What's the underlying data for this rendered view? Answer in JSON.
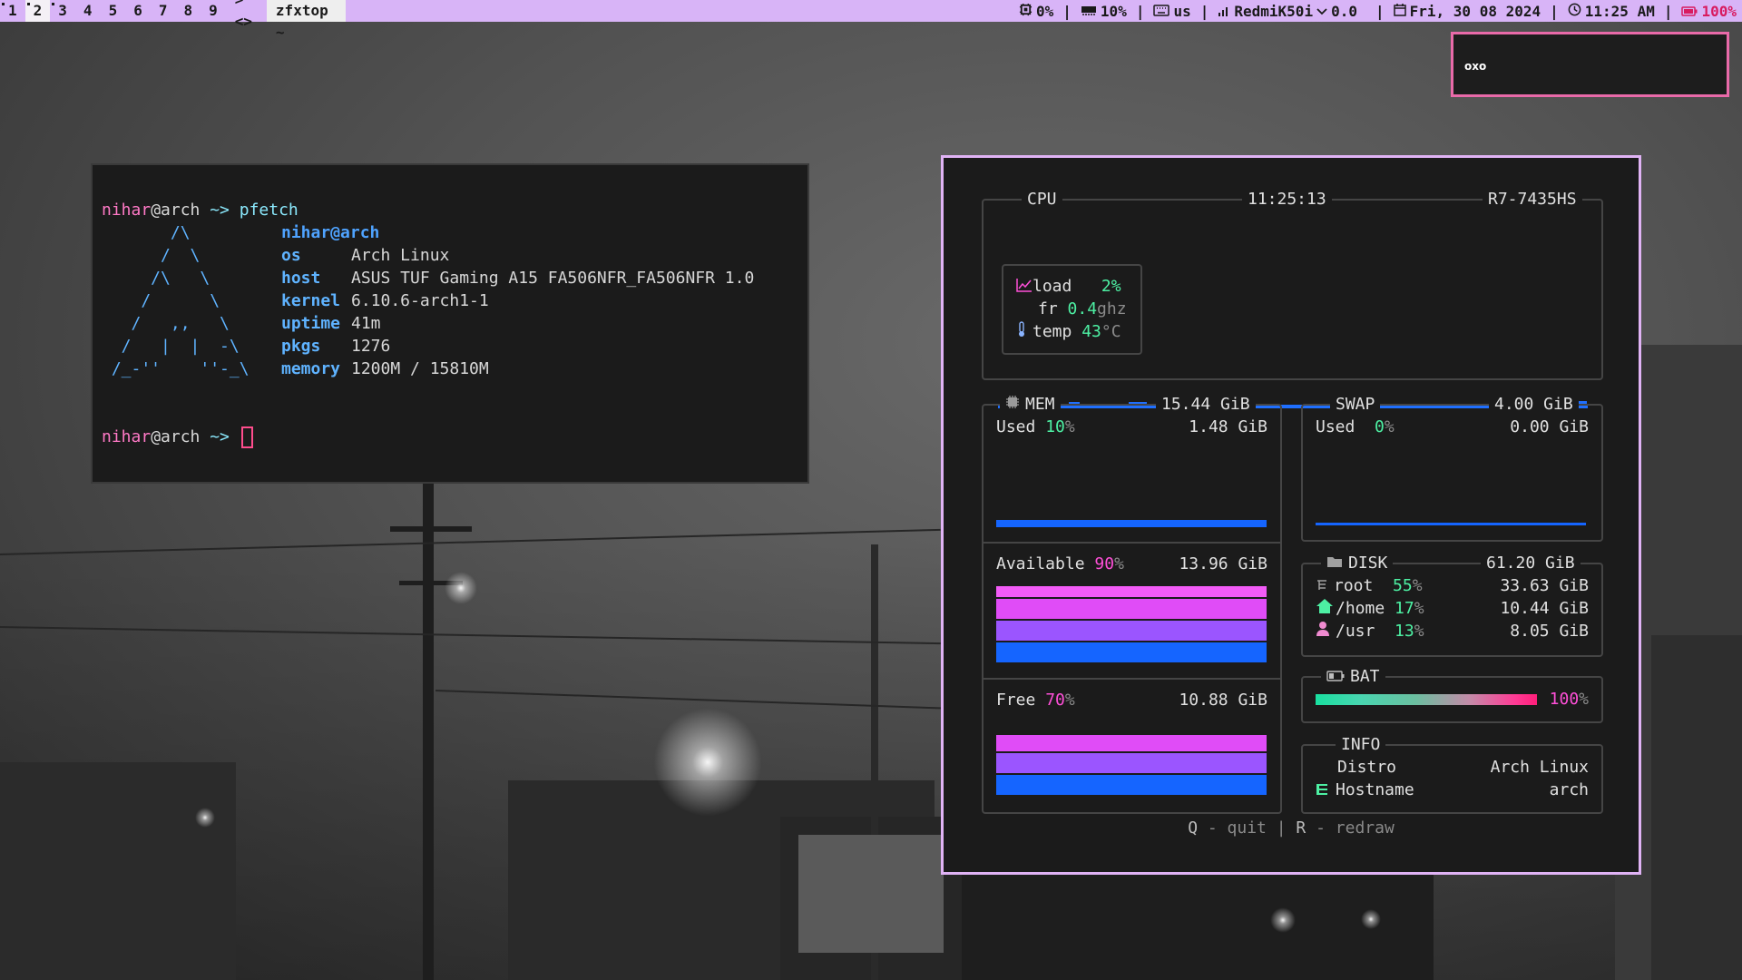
{
  "topbar": {
    "workspaces": [
      "1",
      "2",
      "3",
      "4",
      "5",
      "6",
      "7",
      "8",
      "9"
    ],
    "active_workspace": "2",
    "layout": "><>",
    "window_title": "zfxtop ~",
    "status": {
      "cpu": "0%",
      "memory": "10%",
      "keyboard": "us",
      "network": "RedmiK50i",
      "network_rate": "0.0",
      "date": "Fri, 30 08 2024",
      "time": "11:25 AM",
      "battery": "100%"
    },
    "colors": {
      "bar_bg": "#d8b4f7",
      "active_ws_bg": "#f4f0f6",
      "title_bg": "#eeeeee",
      "battery": "#d81b60"
    }
  },
  "notification": {
    "text": "oxo",
    "border_color": "#e96aa9"
  },
  "terminal": {
    "prompt_user": "nihar",
    "prompt_host": "@arch",
    "prompt_sym": " ~> ",
    "command": "pfetch",
    "ascii_logo": "       /\\\n      /  \\\n     /\\   \\\n    /      \\\n   /   ,,   \\\n  /   |  |  -\\\n /_-''    ''-_\\",
    "user_host": "nihar@arch",
    "info": [
      {
        "key": "os",
        "value": "Arch Linux"
      },
      {
        "key": "host",
        "value": "ASUS TUF Gaming A15 FA506NFR_FA506NFR 1.0"
      },
      {
        "key": "kernel",
        "value": "6.10.6-arch1-1"
      },
      {
        "key": "uptime",
        "value": "41m"
      },
      {
        "key": "pkgs",
        "value": "1276"
      },
      {
        "key": "memory",
        "value": "1200M / 15810M"
      }
    ]
  },
  "zfxtop": {
    "cpu": {
      "title": "CPU",
      "clock": "11:25:13",
      "model": "R7-7435HS",
      "load_label": "load",
      "load_value": "2%",
      "freq_label": "fr",
      "freq_value": "0.4",
      "freq_unit": "ghz",
      "temp_label": "temp",
      "temp_value": "43",
      "temp_unit": "°C"
    },
    "mem": {
      "title": "MEM",
      "total": "15.44 GiB",
      "used_label": "Used",
      "used_pct": "10",
      "used_value": "1.48 GiB",
      "available_label": "Available",
      "available_pct": "90",
      "available_value": "13.96 GiB",
      "free_label": "Free",
      "free_pct": "70",
      "free_value": "10.88 GiB"
    },
    "swap": {
      "title": "SWAP",
      "total": "4.00 GiB",
      "used_label": "Used",
      "used_pct": "0",
      "used_value": "0.00 GiB"
    },
    "disk": {
      "title": "DISK",
      "total": "61.20 GiB",
      "mounts": [
        {
          "name": "root",
          "pct": "55",
          "value": "33.63 GiB",
          "icon": "tree-icon"
        },
        {
          "name": "/home",
          "pct": "17",
          "value": "10.44 GiB",
          "icon": "home-icon"
        },
        {
          "name": "/usr",
          "pct": "13",
          "value": "8.05 GiB",
          "icon": "user-icon"
        }
      ]
    },
    "bat": {
      "title": "BAT",
      "pct": "100",
      "level": 1.0
    },
    "info": {
      "title": "INFO",
      "distro_label": "Distro",
      "distro_value": "Arch Linux",
      "hostname_label": "Hostname",
      "hostname_value": "arch"
    },
    "footer": {
      "quit_key": "Q",
      "quit_label": "quit",
      "redraw_key": "R",
      "redraw_label": "redraw"
    },
    "colors": {
      "accent_green": "#4df0a3",
      "accent_magenta": "#ff4fd8",
      "graph_blue": "#1f6fff",
      "border": "#e0b3f5"
    }
  }
}
